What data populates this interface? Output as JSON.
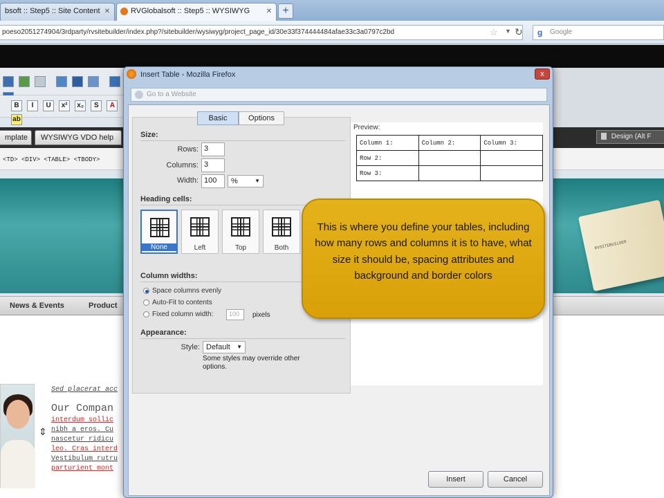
{
  "browser": {
    "tabs": [
      {
        "label": "bsoft :: Step5 :: Site Content"
      },
      {
        "label": "RVGlobalsoft :: Step5 :: WYSIWYG"
      }
    ],
    "new_tab": "+",
    "url": "poeso2051274904/3rdparty/rvsitebuilder/index.php?/sitebuilder/wysiwyg/project_page_id/30e33f374444484afae33c3a0797c2bd",
    "search_engine": "Google",
    "search_logo": "g"
  },
  "editor": {
    "toolbar_buttons": [
      "B",
      "I",
      "U",
      "x²",
      "x₂",
      "S",
      "A",
      "ab"
    ],
    "tabs": [
      "mplate",
      "WYSIWYG VDO help"
    ],
    "design_button": "Design (Alt F",
    "breadcrumb": "<TD> <DIV> <TABLE> <TBODY>",
    "nav_items": [
      "News & Events",
      "Product"
    ],
    "book_text": "RVSITEBUILDER",
    "page_lines": [
      "Sed placerat acc",
      "interdum sollic",
      "nibh a eros. Cu",
      "nascetur ridicu",
      "leo. Cras interd",
      "Vestibulum rutru",
      "parturient mont"
    ],
    "page_title": "Our Compan"
  },
  "dialog": {
    "title": "Insert Table - Mozilla Firefox",
    "url_placeholder": "Go to a Website",
    "close": "x",
    "tabs": {
      "basic": "Basic",
      "options": "Options"
    },
    "size": {
      "heading": "Size:",
      "rows_label": "Rows:",
      "rows_value": "3",
      "columns_label": "Columns:",
      "columns_value": "3",
      "width_label": "Width:",
      "width_value": "100",
      "width_unit": "%"
    },
    "heading_cells": {
      "heading": "Heading cells:",
      "options": [
        "None",
        "Left",
        "Top",
        "Both"
      ],
      "selected": "None"
    },
    "column_widths": {
      "heading": "Column widths:",
      "options": [
        "Space columns evenly",
        "Auto-Fit to contents",
        "Fixed column width:"
      ],
      "fixed_value": "100",
      "unit": "pixels"
    },
    "appearance": {
      "heading": "Appearance:",
      "style_label": "Style:",
      "style_value": "Default",
      "note_line1": "Some styles may override other",
      "note_line2": "options."
    },
    "preview": {
      "label": "Preview:",
      "rows": [
        [
          "Column 1:",
          "Column 2:",
          "Column 3:"
        ],
        [
          "Row 2:",
          "",
          ""
        ],
        [
          "Row 3:",
          "",
          ""
        ]
      ]
    },
    "buttons": {
      "insert": "Insert",
      "cancel": "Cancel"
    }
  },
  "callout": {
    "text": "This is where you define your tables, including how many rows and columns it is to have, what size it should be, spacing attributes and background and border colors",
    "color": "#dea912"
  }
}
